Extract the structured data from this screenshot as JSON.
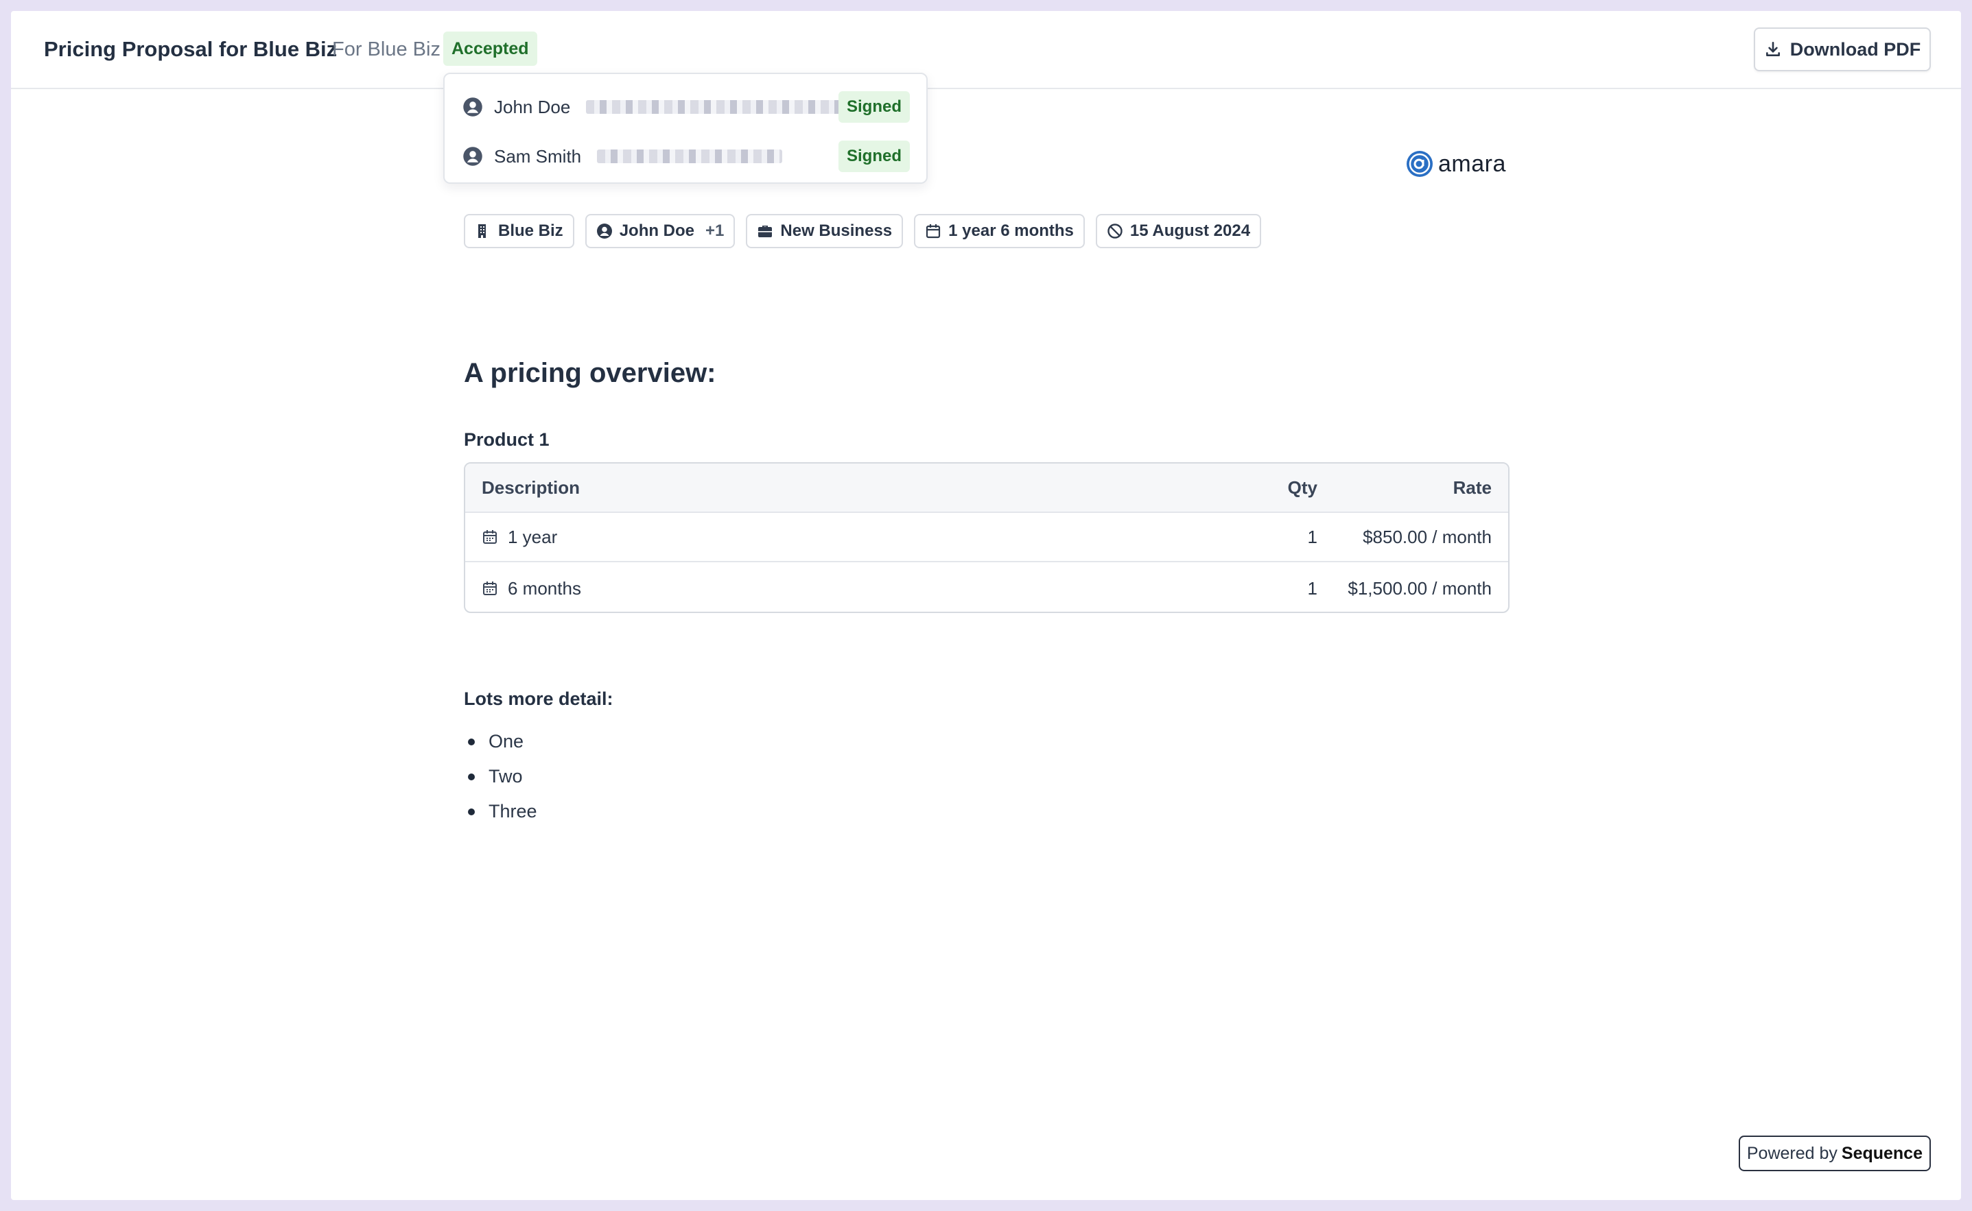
{
  "header": {
    "title": "Pricing Proposal for Blue Biz",
    "subtitle": "For Blue Biz",
    "status": "Accepted",
    "download_label": "Download PDF"
  },
  "signers": [
    {
      "name": "John Doe",
      "status": "Signed"
    },
    {
      "name": "Sam Smith",
      "status": "Signed"
    }
  ],
  "logo": {
    "text": "amara",
    "color": "#2a6fc4"
  },
  "chips": {
    "company": "Blue Biz",
    "contact": "John Doe",
    "contact_extra": "+1",
    "deal_type": "New Business",
    "duration": "1 year 6 months",
    "expiry": "15 August 2024"
  },
  "content": {
    "overview_heading": "A pricing overview:",
    "product_heading": "Product 1",
    "table": {
      "columns": [
        "Description",
        "Qty",
        "Rate"
      ],
      "rows": [
        {
          "description": "1 year",
          "qty": "1",
          "rate": "$850.00 / month"
        },
        {
          "description": "6 months",
          "qty": "1",
          "rate": "$1,500.00 / month"
        }
      ]
    },
    "detail_heading": "Lots more detail:",
    "bullets": [
      "One",
      "Two",
      "Three"
    ]
  },
  "footer": {
    "powered_prefix": "Powered by",
    "powered_brand": "Sequence"
  },
  "colors": {
    "accepted_bg": "#e5f6e5",
    "accepted_text": "#1f6f2a",
    "page_bg": "#e6e1f4"
  }
}
